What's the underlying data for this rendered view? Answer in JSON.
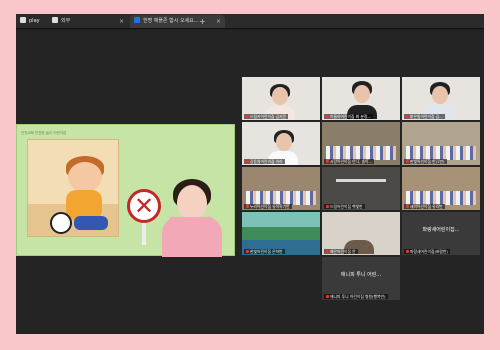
{
  "tabs": [
    {
      "label": "play",
      "icon": "app-icon",
      "accent": "#f2f2f2"
    },
    {
      "label": "외부",
      "icon": "extension-icon",
      "accent": "#f2f2f2"
    },
    {
      "label": "한명 애플존 함시 오세요...",
      "icon": "meet-icon",
      "accent": "#1a73e8"
    }
  ],
  "slide": {
    "header": "안전교육 안전한 놀이 어린이집",
    "sign": "✕"
  },
  "participants": [
    {
      "name": "드림키어린이집 김지윤",
      "kind": "person",
      "accent": "#e53935"
    },
    {
      "name": "아름하어린이집 최 분정...",
      "kind": "person",
      "accent": "#e53935"
    },
    {
      "name": "밝은빛어린이집 김...",
      "kind": "person",
      "accent": "#e53935"
    },
    {
      "name": "강동원어린이집 아라",
      "kind": "person",
      "accent": "#e53935"
    },
    {
      "name": "사랑어린이집 안나, 송이...",
      "kind": "classroom",
      "accent": "#e53935"
    },
    {
      "name": "한빛어린이집 반(1반)",
      "kind": "classroom",
      "accent": "#e53935"
    },
    {
      "name": "누리어린이집 유아학기반",
      "kind": "classroom",
      "accent": "#e53935"
    },
    {
      "name": "드림어린이집 햇빛반",
      "kind": "dark",
      "accent": "#e53935"
    },
    {
      "name": "새싹어린이집 유리반",
      "kind": "classroom",
      "accent": "#e53935"
    },
    {
      "name": "한빛어린이집 은하반",
      "kind": "lake",
      "accent": "#e53935"
    },
    {
      "name": "예은어린이집 안",
      "kind": "wall",
      "accent": "#e53935"
    },
    {
      "name": "파랑새어린이집...",
      "kind": "name",
      "accent": "#e53935",
      "caption": "파랑새어린이집(바람반)"
    },
    {
      "name": "애니피 투니 어린...",
      "kind": "name",
      "accent": "#e53935",
      "caption": "애니피 투니 어린이집 병원(행복반)"
    }
  ]
}
